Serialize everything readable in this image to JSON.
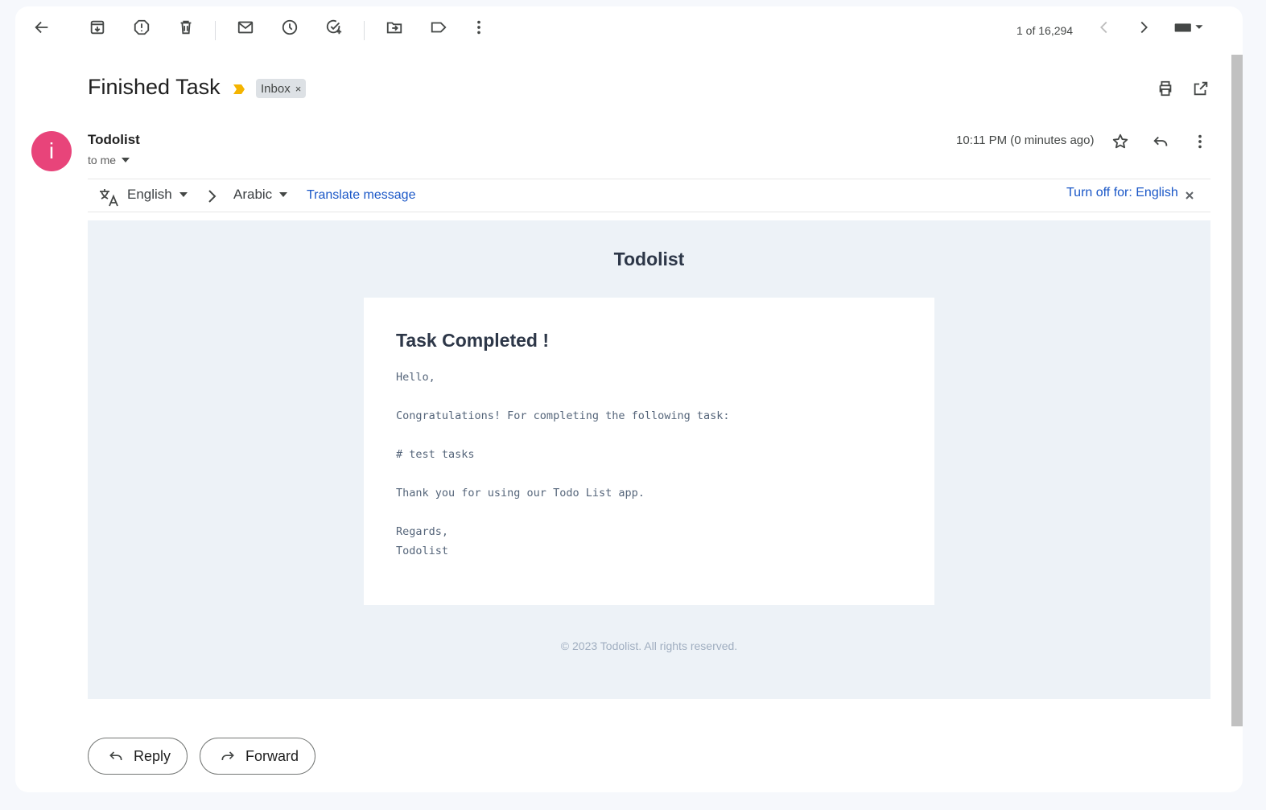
{
  "toolbar": {
    "pager_text": "1 of 16,294"
  },
  "message": {
    "subject": "Finished Task",
    "label": "Inbox",
    "label_remove": "×",
    "sender_initial": "i",
    "sender_name": "Todolist",
    "recipient": "to me",
    "time": "10:11 PM (0 minutes ago)"
  },
  "translate": {
    "from_language": "English",
    "to_language": "Arabic",
    "translate_link": "Translate message",
    "turn_off": "Turn off for: English"
  },
  "email_body": {
    "brand": "Todolist",
    "heading": "Task Completed !",
    "lines": [
      "Hello,",
      "",
      "Congratulations! For completing the following task:",
      "",
      "# test tasks",
      "",
      "Thank you for using our Todo List app.",
      "",
      "Regards,",
      "Todolist"
    ],
    "footer": "© 2023 Todolist. All rights reserved."
  },
  "actions": {
    "reply": "Reply",
    "forward": "Forward"
  },
  "colors": {
    "avatar": "#e8447a",
    "link": "#1a57c7",
    "importance": "#f4b400",
    "email_bg": "#edf2f7"
  }
}
